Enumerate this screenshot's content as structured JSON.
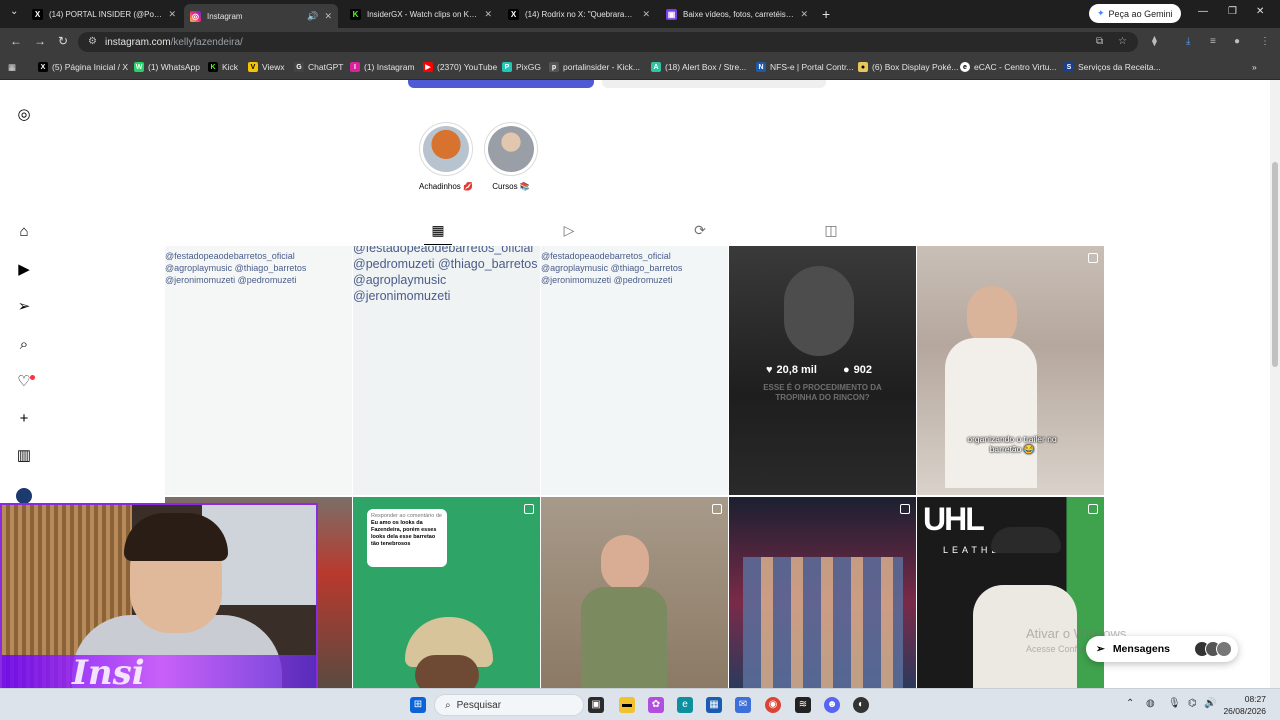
{
  "browser": {
    "tabs": [
      {
        "label": "(14) PORTAL INSIDER (@Portal...",
        "icon": "x-logo-icon",
        "active": false
      },
      {
        "label": "Instagram",
        "icon": "instagram-icon",
        "active": true
      },
      {
        "label": "InsiderGX - Watch clips on Kick",
        "icon": "kick-icon",
        "active": false
      },
      {
        "label": "(14) Rodrix no X: \"Quebraram t...",
        "icon": "x-logo-icon",
        "active": false
      },
      {
        "label": "Baixe vídeos, fotos, carretéis e I...",
        "icon": "download-site-icon",
        "active": false
      }
    ],
    "gemini_button": "Peça ao Gemini",
    "url_host": "instagram.com",
    "url_path": "/kellyfazendeira/",
    "bookmarks": [
      {
        "label": "(5) Página Inicial / X",
        "color": "#000000",
        "glyph": "X"
      },
      {
        "label": "(1) WhatsApp",
        "color": "#25d366",
        "glyph": "W"
      },
      {
        "label": "Kick",
        "color": "#53fc18",
        "glyph": "K"
      },
      {
        "label": "Viewx",
        "color": "#f5c400",
        "glyph": "V"
      },
      {
        "label": "ChatGPT",
        "color": "#444444",
        "glyph": "G"
      },
      {
        "label": "(1) Instagram",
        "color": "#d6249f",
        "glyph": "I"
      },
      {
        "label": "(2370) YouTube",
        "color": "#ff0000",
        "glyph": "▶"
      },
      {
        "label": "PixGG",
        "color": "#21c7b5",
        "glyph": "P"
      },
      {
        "label": "portalinsider - Kick...",
        "color": "#555555",
        "glyph": "p"
      },
      {
        "label": "(18) Alert Box / Stre...",
        "color": "#31c3a2",
        "glyph": "A"
      },
      {
        "label": "NFS-e | Portal Contr...",
        "color": "#1e5aa8",
        "glyph": "N"
      },
      {
        "label": "(6) Box Display Poké...",
        "color": "#e8c65a",
        "glyph": "●"
      },
      {
        "label": "eCAC - Centro Virtu...",
        "color": "#ffffff",
        "glyph": "e"
      },
      {
        "label": "Serviços da Receita...",
        "color": "#1b3f8f",
        "glyph": "S"
      }
    ]
  },
  "profile": {
    "highlights": [
      {
        "label": "Achadinhos 💋",
        "color": "#c96a4f"
      },
      {
        "label": "Cursos 📚",
        "color": "#8b8e94"
      }
    ],
    "tabs": [
      "posts-grid",
      "reels",
      "reposts",
      "tagged"
    ]
  },
  "grid": {
    "row1": [
      {
        "alt": "@festadopeaodebarretos_oficial @agroplaymusic @thiago_barretos @jeronimomuzeti @pedromuzeti",
        "kind": "broken"
      },
      {
        "alt": "@festadopeaodebarretos_oficial @pedromuzeti @thiago_barretos @agroplaymusic @jeronimomuzeti",
        "kind": "broken-zoom"
      },
      {
        "alt": "@festadopeaodebarretos_oficial @agroplaymusic @thiago_barretos @jeronimomuzeti @pedromuzeti",
        "kind": "broken"
      },
      {
        "likes": "20,8 mil",
        "comments": "902",
        "overlay": "ESSE É O PROCEDIMENTO DA TROPINHA DO RINCON?",
        "kind": "hover"
      },
      {
        "caption": "organizando o trailer no barretão 😂",
        "kind": "photo"
      }
    ],
    "row2_comment_bubble": {
      "header": "Responder ao comentário de",
      "text": "Eu amo os looks da Fazendeira, porém esses looks dela esse barretao tão tenebrosos"
    },
    "row2_banner": "LEATHE"
  },
  "messages_pill": "Mensagens",
  "watermark": {
    "line1": "Ativar o Windows",
    "line2": "Acesse Configurações para ativar o Windows."
  },
  "taskbar": {
    "search_placeholder": "Pesquisar",
    "time": "08:27",
    "date": "26/08/2026"
  }
}
